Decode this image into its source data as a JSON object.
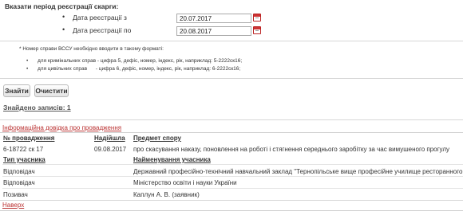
{
  "filter": {
    "title": "Вказати період реєстрації скарги:",
    "date_from_label": "Дата реєстрації з",
    "date_from_value": "20.07.2017",
    "date_to_label": "Дата реєстрації по",
    "date_to_value": "20.08.2017"
  },
  "format_note": {
    "heading": "* Номер справи ВССУ необхідно вводити в такому форматі:",
    "criminal": "для кримінальних справ - цифра 5, дефіс, номер, індекс, рік, наприклад: 5-2222ск16;",
    "civil": "для цивільних справ      - цифра 6, дефіс, номер, індекс, рік, наприклад: 6-2222ск16;"
  },
  "buttons": {
    "search": "Знайти",
    "clear": "Очистити"
  },
  "results": {
    "found_label": "Знайдено записів: 1",
    "info_link": "Інформаційна довідка про провадження",
    "headers": {
      "case_number": "№ провадження",
      "received": "Надійшла",
      "subject": "Предмет спору"
    },
    "case": {
      "number": "6-18722 ск 17",
      "received": "09.08.2017",
      "subject": "про скасування наказу, поновлення на роботі і стягнення середнього заробітку за час вимушеного прогулу"
    },
    "participant_headers": {
      "type": "Тип учасника",
      "name": "Найменування учасника"
    },
    "participants": [
      {
        "type": "Відповідач",
        "name": "Державний професійно-технічний навчальний заклад \"Тернопільське вище професійне училище ресторанного сервісу і"
      },
      {
        "type": "Відповідач",
        "name": "Міністерство освіти і науки України"
      },
      {
        "type": "Позивач",
        "name": "Каплун А. В. (заявник)"
      }
    ],
    "top_link": "Наверх"
  },
  "colors": {
    "link_red": "#b33333",
    "text": "#333333",
    "divider": "#d6d6d6"
  }
}
